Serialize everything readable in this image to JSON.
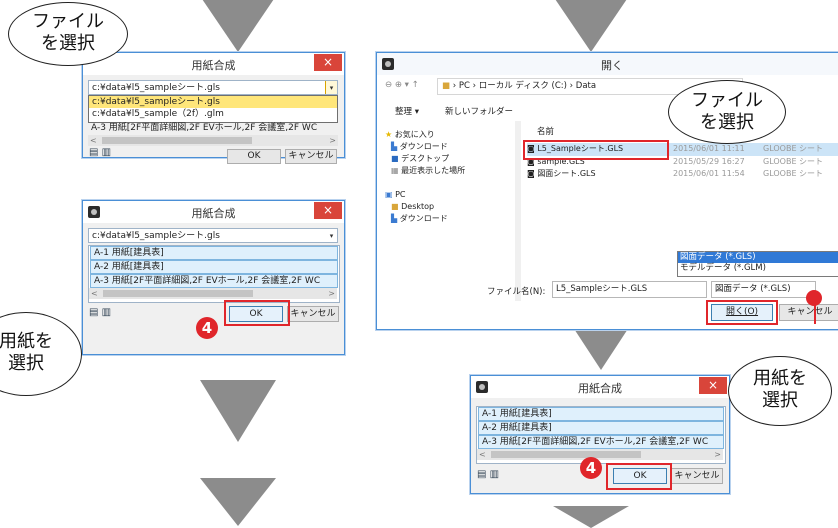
{
  "dialog_top": {
    "title": "用紙合成",
    "close": "×",
    "path": "c:¥data¥l5_sampleシート.gls",
    "dropdown_items": [
      "c:¥data¥l5_sampleシート.gls",
      "c:¥data¥l5_sample（2f）.glm"
    ],
    "list_item": "A-3 用紙[2F平面詳細図,2F EVホール,2F 会議室,2F WC",
    "ok": "OK",
    "cancel": "キャンセル"
  },
  "dialog_mid": {
    "title": "用紙合成",
    "close": "×",
    "path": "c:¥data¥l5_sampleシート.gls",
    "items": [
      "A-1 用紙[建具表]",
      "A-2 用紙[建具表]",
      "A-3 用紙[2F平面詳細図,2F EVホール,2F 会議室,2F WC"
    ],
    "ok": "OK",
    "cancel": "キャンセル"
  },
  "open_dialog": {
    "title": "開く",
    "breadcrumb": [
      "PC",
      "ローカル ディスク (C:)",
      "Data"
    ],
    "toolbar": {
      "organize": "整理 ▾",
      "new_folder": "新しいフォルダー"
    },
    "nav": [
      "お気に入り",
      "ダウンロード",
      "デスクトップ",
      "最近表示した場所",
      "PC",
      "Desktop",
      "ダウンロード"
    ],
    "column_name": "名前",
    "files": [
      {
        "name": "L5_Sampleシート.GLS",
        "date": "2015/06/01 11:11",
        "type": "GLOOBE シート"
      },
      {
        "name": "sample.GLS",
        "date": "2015/05/29 16:27",
        "type": "GLOOBE シート"
      },
      {
        "name": "図面シート.GLS",
        "date": "2015/06/01 11:54",
        "type": "GLOOBE シート"
      }
    ],
    "filetype_options": [
      "図面データ (*.GLS)",
      "モデルデータ (*.GLM)"
    ],
    "filename_label": "ファイル名(N):",
    "filename_value": "L5_Sampleシート.GLS",
    "filetype_selected": "図面データ (*.GLS)",
    "open_button": "開く(O)",
    "cancel_button": "キャンセル"
  },
  "dialog_bottom": {
    "title": "用紙合成",
    "close": "×",
    "items": [
      "A-1 用紙[建具表]",
      "A-2 用紙[建具表]",
      "A-3 用紙[2F平面詳細図,2F EVホール,2F 会議室,2F WC"
    ],
    "ok": "OK",
    "cancel": "キャンセル"
  },
  "callouts": {
    "select_file_left": [
      "ファイル",
      "を選択"
    ],
    "select_paper_left": [
      "用紙を",
      "選択"
    ],
    "select_file_right": [
      "ファイル",
      "を選択"
    ],
    "select_paper_right": [
      "用紙を",
      "選択"
    ],
    "step_number": "4"
  },
  "colors": {
    "accent_red": "#e0262b",
    "arrow_gray": "#8c8c8c",
    "close_red": "#d9453a",
    "selection_yellow": "#ffe67a"
  }
}
